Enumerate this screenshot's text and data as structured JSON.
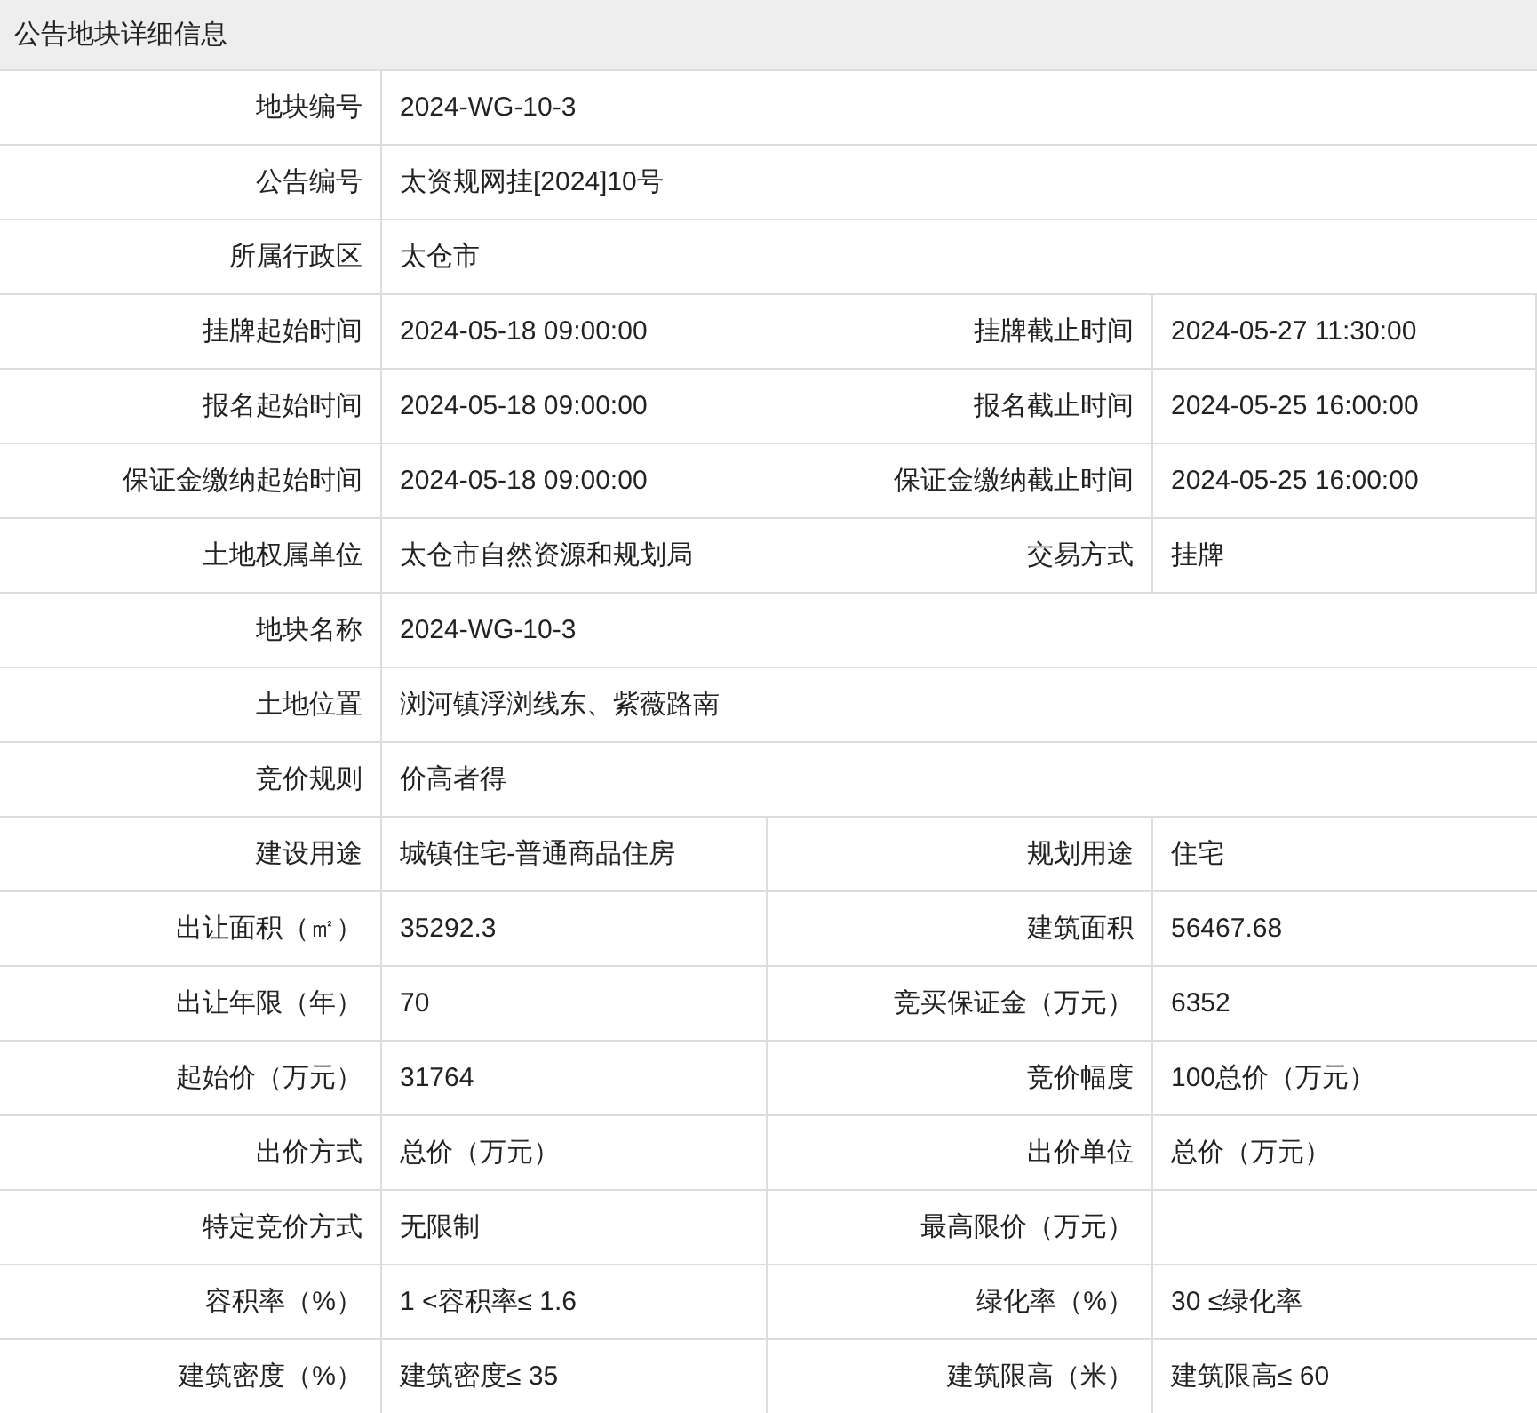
{
  "panel": {
    "title": "公告地块详细信息"
  },
  "rows": [
    {
      "fields": [
        {
          "label": "地块编号",
          "value": "2024-WG-10-3"
        }
      ]
    },
    {
      "fields": [
        {
          "label": "公告编号",
          "value": "太资规网挂[2024]10号"
        }
      ]
    },
    {
      "fields": [
        {
          "label": "所属行政区",
          "value": "太仓市"
        }
      ]
    },
    {
      "fields": [
        {
          "label": "挂牌起始时间",
          "value": "2024-05-18 09:00:00"
        },
        {
          "label": "挂牌截止时间",
          "value": "2024-05-27 11:30:00"
        }
      ]
    },
    {
      "fields": [
        {
          "label": "报名起始时间",
          "value": "2024-05-18 09:00:00"
        },
        {
          "label": "报名截止时间",
          "value": "2024-05-25 16:00:00"
        }
      ]
    },
    {
      "fields": [
        {
          "label": "保证金缴纳起始时间",
          "value": "2024-05-18 09:00:00"
        },
        {
          "label": "保证金缴纳截止时间",
          "value": "2024-05-25 16:00:00"
        }
      ]
    },
    {
      "fields": [
        {
          "label": "土地权属单位",
          "value": "太仓市自然资源和规划局"
        },
        {
          "label": "交易方式",
          "value": "挂牌"
        }
      ]
    },
    {
      "fields": [
        {
          "label": "地块名称",
          "value": "2024-WG-10-3"
        }
      ]
    },
    {
      "fields": [
        {
          "label": "土地位置",
          "value": "浏河镇浮浏线东、紫薇路南"
        }
      ]
    },
    {
      "fields": [
        {
          "label": "竞价规则",
          "value": "价高者得"
        }
      ]
    },
    {
      "fields": [
        {
          "label": "建设用途",
          "value": "城镇住宅-普通商品住房"
        },
        {
          "label": "规划用途",
          "value": "住宅"
        }
      ]
    },
    {
      "fields": [
        {
          "label": "出让面积（㎡）",
          "value": "35292.3"
        },
        {
          "label": "建筑面积",
          "value": "56467.68"
        }
      ]
    },
    {
      "fields": [
        {
          "label": "出让年限（年）",
          "value": "70"
        },
        {
          "label": "竞买保证金（万元）",
          "value": "6352"
        }
      ]
    },
    {
      "fields": [
        {
          "label": "起始价（万元）",
          "value": "31764"
        },
        {
          "label": "竞价幅度",
          "value": "100总价（万元）"
        }
      ]
    },
    {
      "fields": [
        {
          "label": "出价方式",
          "value": "总价（万元）"
        },
        {
          "label": "出价单位",
          "value": "总价（万元）"
        }
      ]
    },
    {
      "fields": [
        {
          "label": "特定竞价方式",
          "value": "无限制"
        },
        {
          "label": "最高限价（万元）"
        }
      ]
    },
    {
      "fields": [
        {
          "label": "容积率（%）",
          "value": "1 <容积率≤ 1.6"
        },
        {
          "label": "绿化率（%）",
          "value": "30 ≤绿化率"
        }
      ]
    },
    {
      "fields": [
        {
          "label": "建筑密度（%）",
          "value": "建筑密度≤ 35"
        },
        {
          "label": "建筑限高（米）",
          "value": "建筑限高≤ 60"
        }
      ]
    }
  ]
}
